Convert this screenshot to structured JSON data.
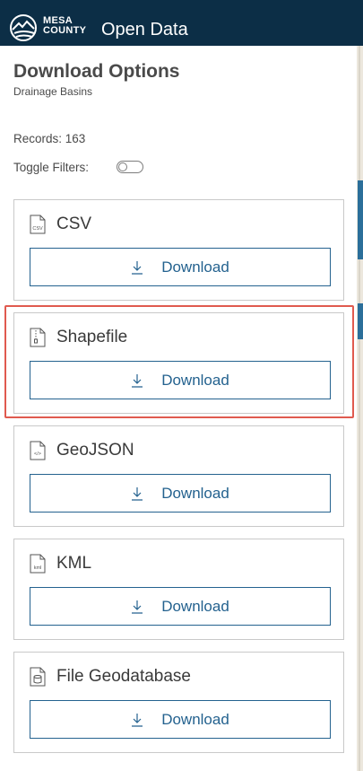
{
  "header": {
    "brand_line1": "MESA",
    "brand_line2": "COUNTY",
    "app_title": "Open Data"
  },
  "panel": {
    "title": "Download Options",
    "subtitle": "Drainage Basins",
    "records": "Records: 163",
    "toggle_filters_label": "Toggle Filters:",
    "toggle_filters_on": false
  },
  "download_options": [
    {
      "format": "CSV",
      "icon": "csv-file-icon",
      "icon_text": "CSV",
      "button_label": "Download"
    },
    {
      "format": "Shapefile",
      "icon": "zip-file-icon",
      "icon_text": "",
      "button_label": "Download"
    },
    {
      "format": "GeoJSON",
      "icon": "code-file-icon",
      "icon_text": "</>",
      "button_label": "Download"
    },
    {
      "format": "KML",
      "icon": "kml-file-icon",
      "icon_text": "kml",
      "button_label": "Download"
    },
    {
      "format": "File Geodatabase",
      "icon": "database-file-icon",
      "icon_text": "",
      "button_label": "Download"
    }
  ],
  "colors": {
    "header_bg": "#0c2e46",
    "accent": "#24628f",
    "highlight": "#e05a4f"
  }
}
